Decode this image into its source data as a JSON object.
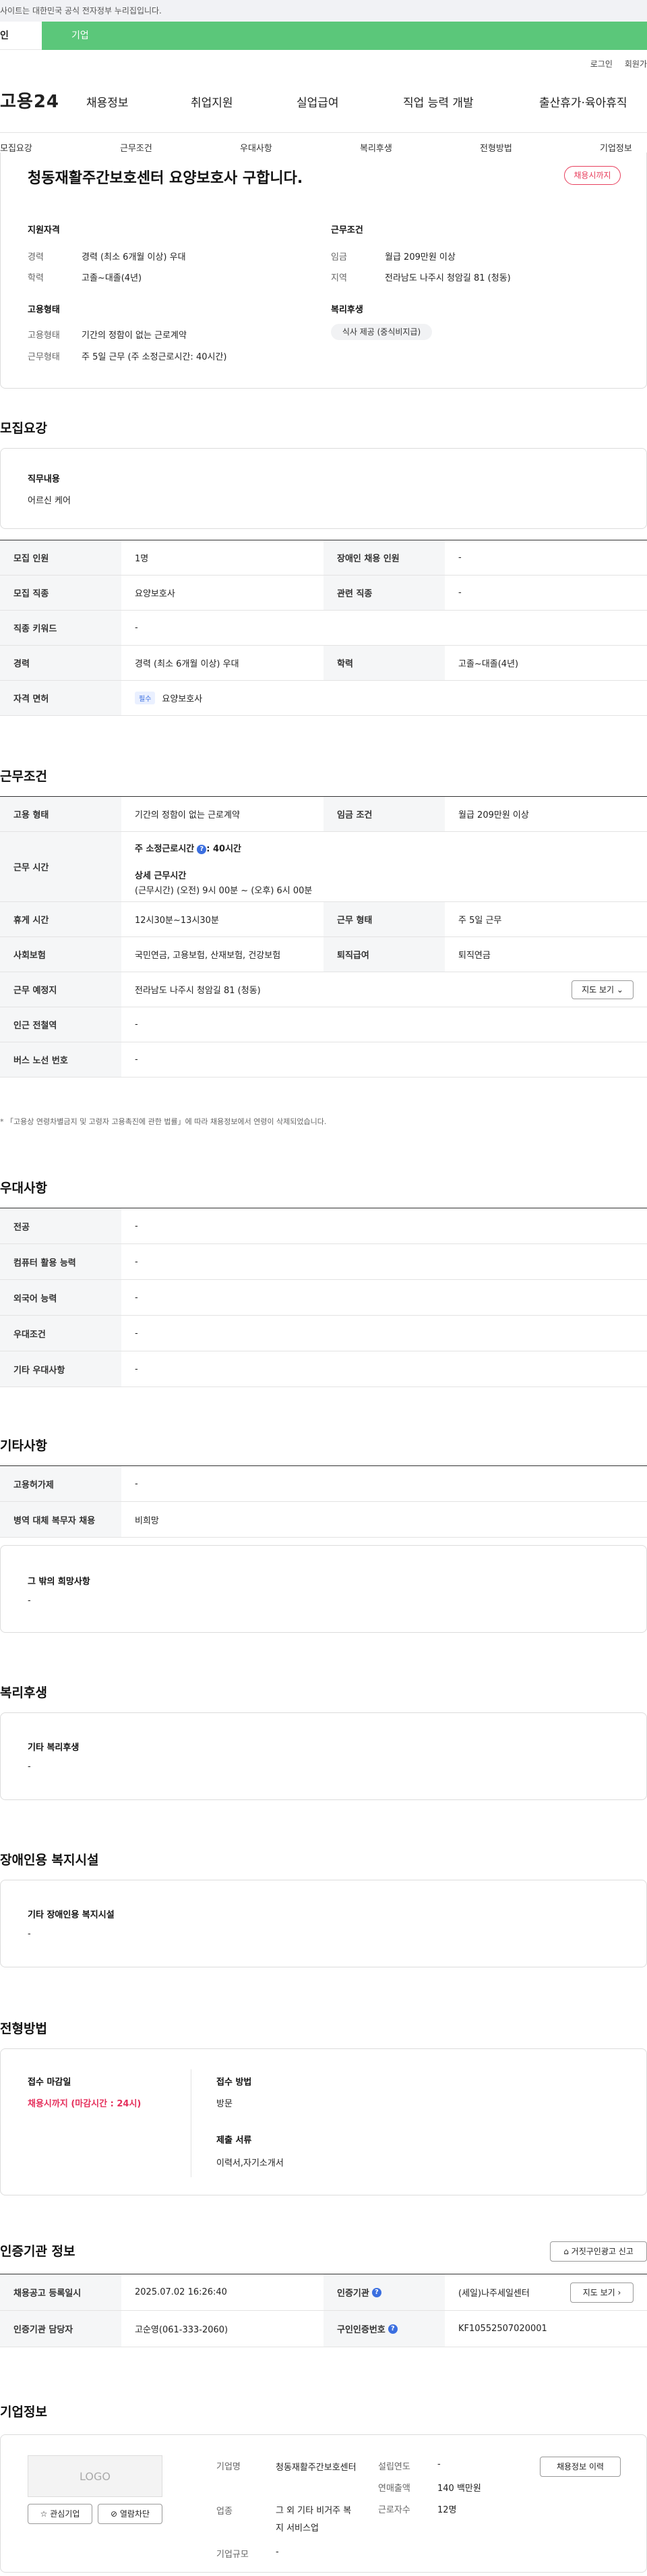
{
  "topbar": {
    "notice": "사이트는 대한민국 공식 전자정부 누리집입니다."
  },
  "typebar": {
    "personal": "인",
    "company": "기업"
  },
  "util": {
    "login": "로그인",
    "join": "회원가"
  },
  "logo": "고용24",
  "gnb": [
    "채용정보",
    "취업지원",
    "실업급여",
    "직업 능력 개발",
    "출산휴가·육아휴직"
  ],
  "tabs": [
    "모집요강",
    "근무조건",
    "우대사항",
    "복리후생",
    "전형방법",
    "기업정보"
  ],
  "job": {
    "title": "청동재활주간보호센터 요양보호사 구합니다.",
    "status": "채용시까지",
    "qual_title": "지원자격",
    "career_label": "경력",
    "career_value": "경력 (최소 6개월 이상) 우대",
    "edu_label": "학력",
    "edu_value": "고졸~대졸(4년)",
    "emp_title": "고용형태",
    "emp_label": "고용형태",
    "emp_value": "기간의 정함이 없는 근로계약",
    "work_label": "근무형태",
    "work_value": "주 5일 근무 (주 소정근로시간: 40시간)",
    "cond_title": "근무조건",
    "wage_label": "임금",
    "wage_value": "월급 209만원 이상",
    "region_label": "지역",
    "region_value": "전라남도 나주시 청암길 81 (청동)",
    "welfare_title": "복리후생",
    "welfare_chip": "식사 제공 (중식비지급)"
  },
  "recruit": {
    "title": "모집요강",
    "duty_label": "직무내용",
    "duty_value": "어르신 케어",
    "rows": [
      {
        "a": "모집 인원",
        "b": "1명",
        "c": "장애인 채용 인원",
        "d": "-"
      },
      {
        "a": "모집 직종",
        "b": "요양보호사",
        "c": "관련 직종",
        "d": "-"
      },
      {
        "a": "직종 키워드",
        "b": "-"
      },
      {
        "a": "경력",
        "b": "경력 (최소 6개월 이상) 우대",
        "c": "학력",
        "d": "고졸~대졸(4년)"
      },
      {
        "a": "자격 면허",
        "tag": "필수",
        "b": "요양보호사"
      }
    ]
  },
  "cond": {
    "title": "근무조건",
    "emp_type_label": "고용 형태",
    "emp_type_value": "기간의 정함이 없는 근로계약",
    "wage_label": "임금 조건",
    "wage_value": "월급 209만원 이상",
    "hours_label": "근무 시간",
    "hours_week": "주 소정근로시간",
    "hours_week_value": ": 40시간",
    "hours_detail_label": "상세 근무시간",
    "hours_detail_value": "(근무시간) (오전) 9시 00분 ~ (오후) 6시 00분",
    "break_label": "휴게 시간",
    "break_value": "12시30분~13시30분",
    "form_label": "근무 형태",
    "form_value": "주 5일 근무",
    "insurance_label": "사회보험",
    "insurance_value": "국민연금, 고용보험, 산재보험, 건강보험",
    "retire_label": "퇴직급여",
    "retire_value": "퇴직연금",
    "place_label": "근무 예정지",
    "place_value": "전라남도 나주시 청암길 81 (청동)",
    "map_btn": "지도 보기",
    "subway_label": "인근 전철역",
    "subway_value": "-",
    "bus_label": "버스 노선 번호",
    "bus_value": "-",
    "note": "* 「고용상 연령차별금지 및 고령자 고용촉진에 관한 법률」에 따라 채용정보에서 연령이 삭제되었습니다."
  },
  "pref": {
    "title": "우대사항",
    "rows": [
      {
        "a": "전공",
        "b": "-"
      },
      {
        "a": "컴퓨터 활용 능력",
        "b": "-"
      },
      {
        "a": "외국어 능력",
        "b": "-"
      },
      {
        "a": "우대조건",
        "b": "-"
      },
      {
        "a": "기타 우대사항",
        "b": "-"
      }
    ]
  },
  "etc": {
    "title": "기타사항",
    "rows": [
      {
        "a": "고용허가제",
        "b": "-"
      },
      {
        "a": "병역 대체 복무자 채용",
        "b": "비희망"
      }
    ],
    "other_label": "그 밖의 희망사항",
    "other_value": "-"
  },
  "welfare": {
    "title": "복리후생",
    "label": "기타 복리후생",
    "value": "-"
  },
  "disabled": {
    "title": "장애인용 복지시설",
    "label": "기타 장애인용 복지시설",
    "value": "-"
  },
  "screen": {
    "title": "전형방법",
    "deadline_label": "접수 마감일",
    "deadline_value": "채용시까지 (마감시간 : 24시)",
    "method_label": "접수 방법",
    "method_value": "방문",
    "docs_label": "제출 서류",
    "docs_value": "이력서,자기소개서"
  },
  "agency": {
    "title": "인증기관 정보",
    "report_btn": "거짓구인광고 신고",
    "reg_label": "채용공고 등록일시",
    "reg_value": "2025.07.02 16:26:40",
    "inst_label": "인증기관",
    "inst_value": "(세일)나주세일센터",
    "map_btn": "지도 보기",
    "manager_label": "인증기관 담당자",
    "manager_value": "고순영(061-333-2060)",
    "num_label": "구인인증번호",
    "num_value": "KF10552507020001"
  },
  "company": {
    "title": "기업정보",
    "logo": "LOGO",
    "interest_btn": "관심기업",
    "block_btn": "열람차단",
    "name_label": "기업명",
    "name_value": "청동재활주간보호센터",
    "industry_label": "업종",
    "industry_value": "그 외 기타 비거주 복지 서비스업",
    "size_label": "기업규모",
    "size_value": "-",
    "found_label": "설립연도",
    "found_value": "-",
    "sales_label": "연매출액",
    "sales_value": "140 백만원",
    "staff_label": "근로자수",
    "staff_value": "12명",
    "history_btn": "채용정보 이력"
  }
}
